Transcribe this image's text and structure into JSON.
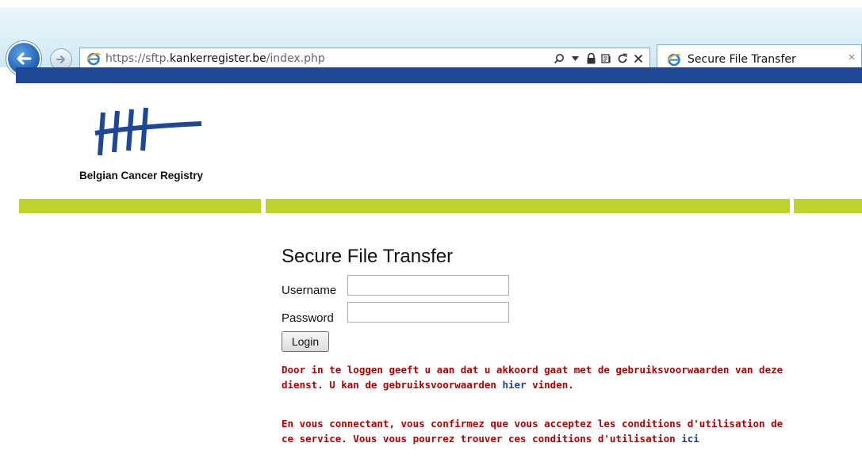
{
  "browser": {
    "url_prefix": "https://sftp.",
    "url_domain": "kankerregister.be",
    "url_path": "/index.php",
    "tab_title": "Secure File Transfer",
    "tab_close": "×"
  },
  "logo": {
    "text": "Belgian Cancer Registry"
  },
  "form": {
    "title": "Secure File Transfer",
    "username_label": "Username",
    "username_value": "",
    "password_label": "Password",
    "password_value": "",
    "login_label": "Login"
  },
  "notice_nl": {
    "text": "Door in te loggen geeft u aan dat u akkoord gaat met de gebruiksvoorwaarden van deze dienst. U kan de gebruiksvoorwaarden",
    "link": "hier",
    "suffix": "vinden."
  },
  "notice_fr": {
    "text": "En vous connectant, vous confirmez que vous acceptez les conditions d'utilisation de ce service. Vous vous pourrez trouver ces conditions d'utilisation",
    "link": "ici"
  },
  "colors": {
    "header_blue": "#1e4796",
    "accent_green": "#bfd22e",
    "notice_red": "#b00000",
    "link_blue": "#1e3e9e"
  }
}
